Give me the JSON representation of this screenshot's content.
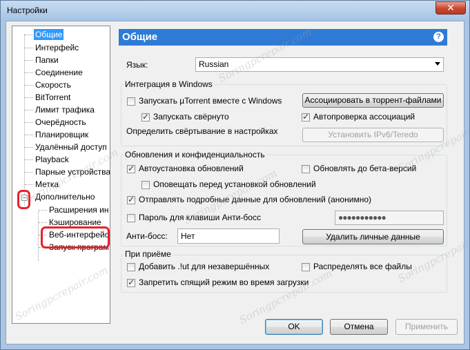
{
  "window": {
    "title": "Настройки",
    "close_glyph": "✕"
  },
  "tree": {
    "items": [
      {
        "label": "Общие"
      },
      {
        "label": "Интерфейс"
      },
      {
        "label": "Папки"
      },
      {
        "label": "Соединение"
      },
      {
        "label": "Скорость"
      },
      {
        "label": "BitTorrent"
      },
      {
        "label": "Лимит трафика"
      },
      {
        "label": "Очерёдность"
      },
      {
        "label": "Планировщик"
      },
      {
        "label": "Удалённый доступ"
      },
      {
        "label": "Playback"
      },
      {
        "label": "Парные устройства"
      },
      {
        "label": "Метка"
      },
      {
        "label": "Дополнительно"
      },
      {
        "label": "Расширения ин"
      },
      {
        "label": "Кэширование"
      },
      {
        "label": "Веб-интерфейс"
      },
      {
        "label": "Запуск програм"
      }
    ],
    "expander_glyph": "−"
  },
  "header": {
    "title": "Общие",
    "help_glyph": "?"
  },
  "language": {
    "label": "Язык:",
    "value": "Russian"
  },
  "windows_integration": {
    "title": "Интеграция в Windows",
    "start_with_windows": {
      "label": "Запускать µTorrent вместе с Windows",
      "checked": false
    },
    "start_minimized": {
      "label": "Запускать свёрнуто",
      "checked": true
    },
    "minimize_hint": "Определить свёртывание в настройках",
    "associate_button": "Ассоциировать в торрент-файлами",
    "auto_check_assoc": {
      "label": "Автопроверка ассоциаций",
      "checked": true
    },
    "ipv6_button": "Установить IPv6/Teredo"
  },
  "updates": {
    "title": "Обновления и конфиденциальность",
    "auto_install": {
      "label": "Автоустановка обновлений",
      "checked": true
    },
    "beta_updates": {
      "label": "Обновлять до бета-версий",
      "checked": false
    },
    "notify_before": {
      "label": "Оповещать перед установкой обновлений",
      "checked": false
    },
    "send_data": {
      "label": "Отправлять подробные данные для обновлений (анонимно)",
      "checked": true
    },
    "boss_password": {
      "label": "Пароль для клавиши Анти-босс",
      "checked": false
    },
    "password_value": "●●●●●●●●●●●",
    "boss_label": "Анти-босс:",
    "boss_value": "Нет",
    "delete_button": "Удалить личные данные"
  },
  "on_receive": {
    "title": "При приёме",
    "add_ut": {
      "label": "Добавить .!ut для незавершённых",
      "checked": false
    },
    "distribute": {
      "label": "Распределять все файлы",
      "checked": false
    },
    "prevent_sleep": {
      "label": "Запретить спящий режим во время загрузки",
      "checked": true
    }
  },
  "footer": {
    "ok": "OK",
    "cancel": "Отмена",
    "apply": "Применить"
  },
  "watermark_text": "Soringpcrepair.com"
}
